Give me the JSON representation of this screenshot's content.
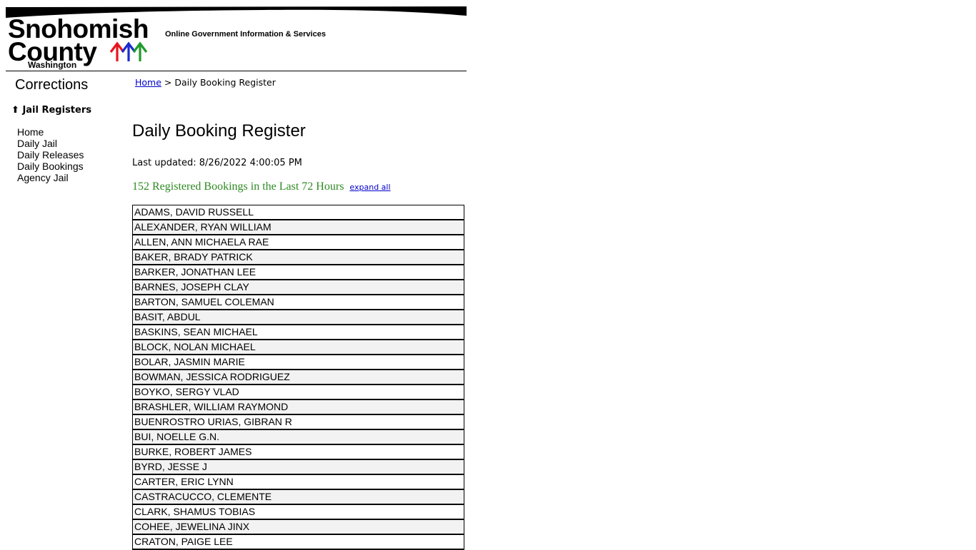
{
  "header": {
    "logo_line1": "Snohomish",
    "logo_line2": "County",
    "logo_line3": "Washington",
    "tagline": "Online Government Information & Services",
    "tree_colors": [
      "#e8141c",
      "#1a2ccf",
      "#1e9c2a"
    ]
  },
  "sidebar": {
    "section_title": "Corrections",
    "group_title": "Jail Registers",
    "group_icon": "tree-arrow-icon",
    "items": [
      {
        "label": "Home"
      },
      {
        "label": "Daily Jail"
      },
      {
        "label": "Daily Releases"
      },
      {
        "label": "Daily Bookings"
      },
      {
        "label": "Agency Jail"
      }
    ]
  },
  "breadcrumb": {
    "home": "Home",
    "separator": ">",
    "current": "Daily Booking Register"
  },
  "main": {
    "title": "Daily Booking Register",
    "last_updated": "Last updated: 8/26/2022 4:00:05 PM",
    "count_text": "152 Registered Bookings in the Last 72 Hours",
    "expand_all": "expand all",
    "accent_color": "#2e8b22"
  },
  "bookings": [
    "ADAMS, DAVID RUSSELL",
    "ALEXANDER, RYAN WILLIAM",
    "ALLEN, ANN MICHAELA RAE",
    "BAKER, BRADY PATRICK",
    "BARKER, JONATHAN LEE",
    "BARNES, JOSEPH CLAY",
    "BARTON, SAMUEL COLEMAN",
    "BASIT, ABDUL",
    "BASKINS, SEAN MICHAEL",
    "BLOCK, NOLAN MICHAEL",
    "BOLAR, JASMIN MARIE",
    "BOWMAN, JESSICA RODRIGUEZ",
    "BOYKO, SERGY VLAD",
    "BRASHLER, WILLIAM RAYMOND",
    "BUENROSTRO URIAS, GIBRAN R",
    "BUI, NOELLE G.N.",
    "BURKE, ROBERT JAMES",
    "BYRD, JESSE J",
    "CARTER, ERIC LYNN",
    "CASTRACUCCO, CLEMENTE",
    "CLARK, SHAMUS TOBIAS",
    "COHEE, JEWELINA JINX",
    "CRATON, PAIGE LEE"
  ]
}
